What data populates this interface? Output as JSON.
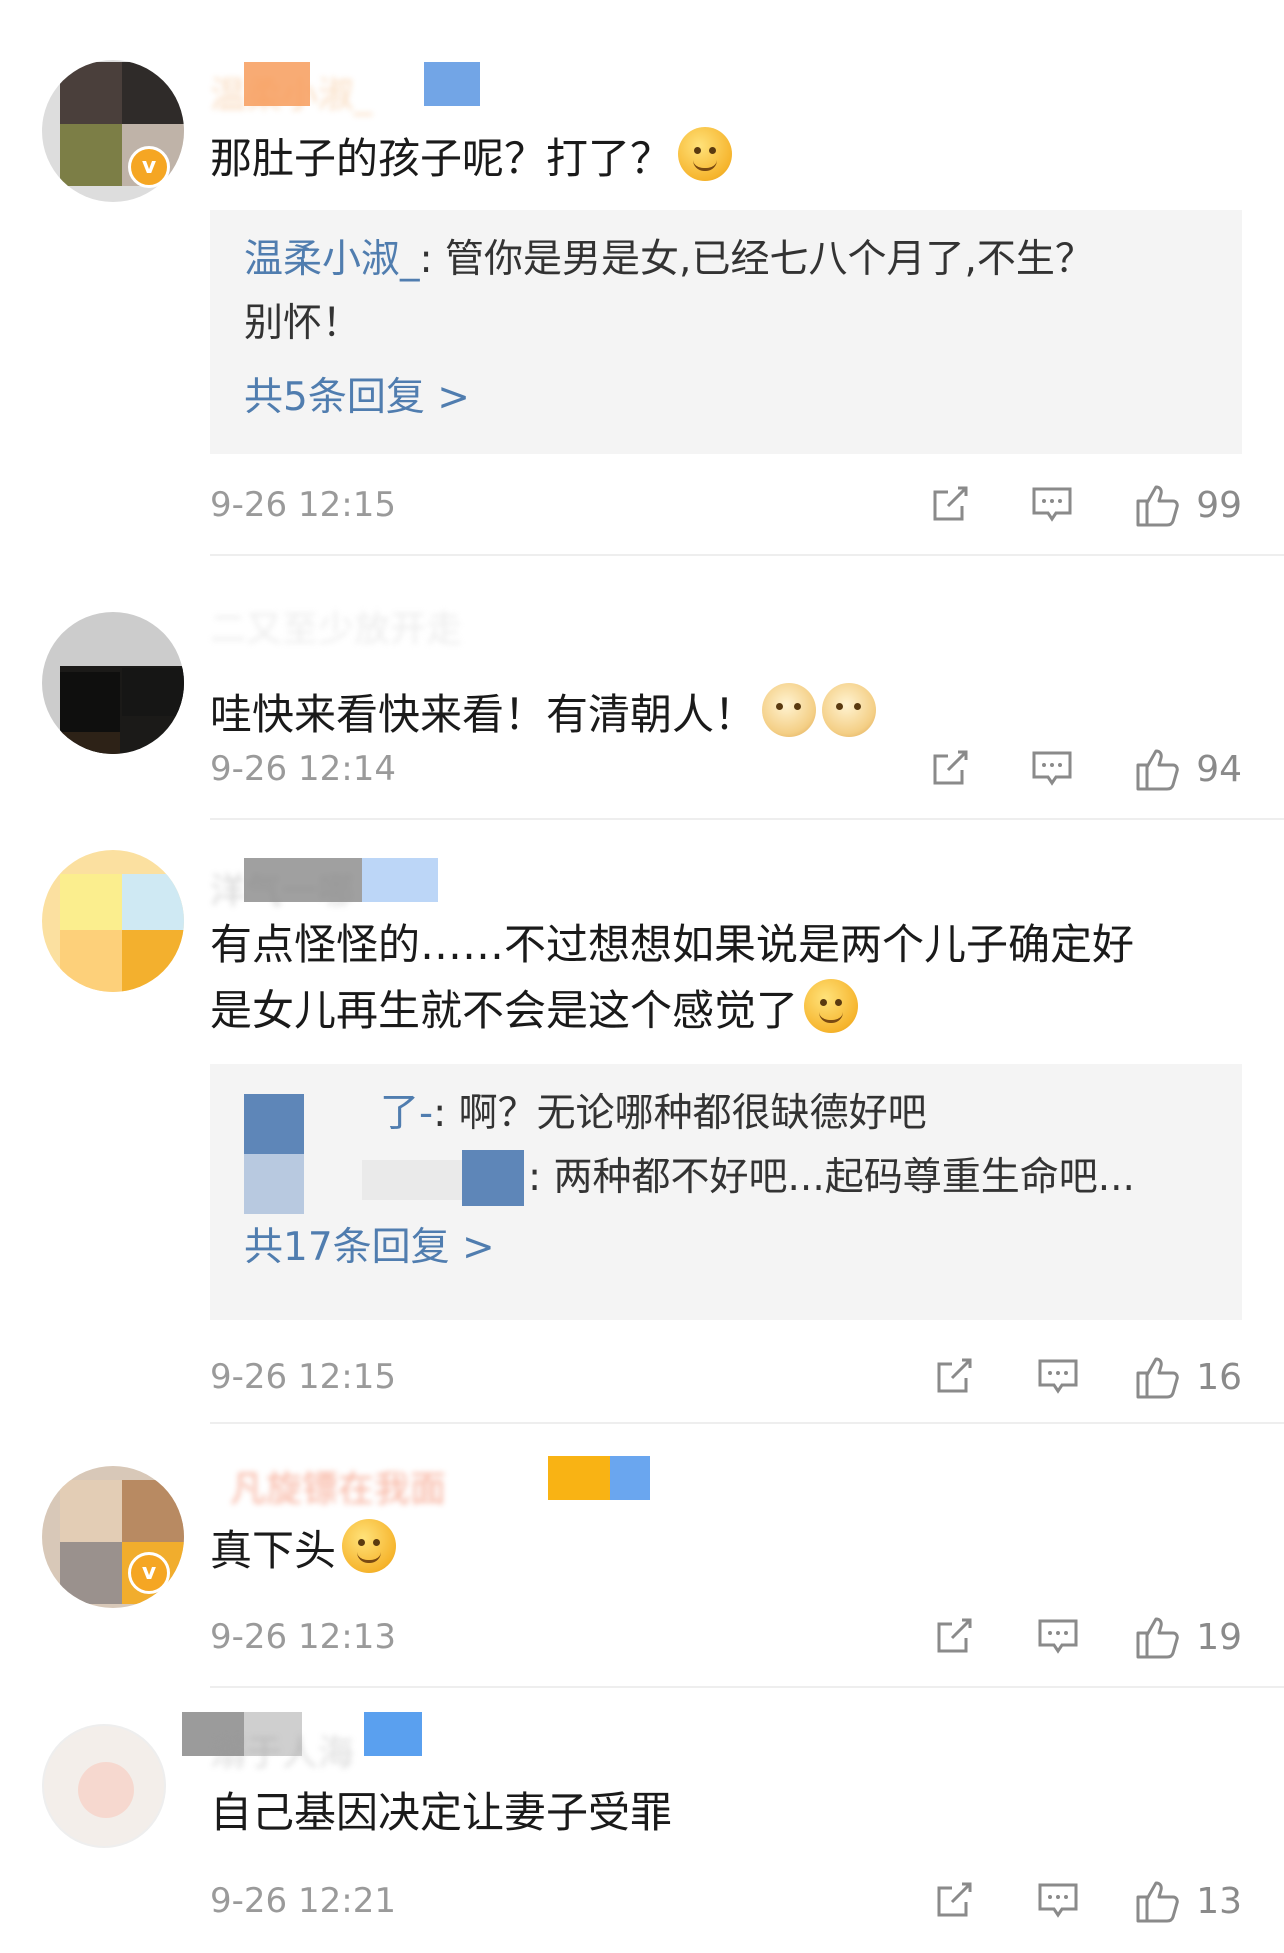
{
  "comments": [
    {
      "text": "那肚子的孩子呢？打了？",
      "verified": true,
      "replies": [
        {
          "author": "温柔小淑_",
          "text": ": 管你是男是女,已经七八个月了,不生？",
          "cont": "别怀！"
        }
      ],
      "more": "共5条回复 >",
      "time": "9-26 12:15",
      "likes": "99"
    },
    {
      "text": "哇快来看快来看！有清朝人！",
      "verified": false,
      "time": "9-26 12:14",
      "likes": "94"
    },
    {
      "text": "有点怪怪的……不过想想如果说是两个儿子确定好",
      "text2": "是女儿再生就不会是这个感觉了",
      "verified": false,
      "replies": [
        {
          "author": "了-",
          "text": ": 啊？无论哪种都很缺德好吧"
        },
        {
          "author": "",
          "text": ": 两种都不好吧...起码尊重生命吧..."
        }
      ],
      "more": "共17条回复 >",
      "time": "9-26 12:15",
      "likes": "16"
    },
    {
      "text": "真下头",
      "verified": true,
      "time": "9-26 12:13",
      "likes": "19"
    },
    {
      "text": "自己基因决定让妻子受罪",
      "verified": false,
      "time": "9-26 12:21",
      "likes": "13"
    }
  ],
  "icons": {
    "share": "share-icon",
    "comment": "comment-icon",
    "like": "thumbs-up-icon"
  },
  "colors": {
    "link": "#507daf",
    "time": "#9a9a9a",
    "reply_bg": "#f4f4f4",
    "verified": "#f5a623"
  }
}
